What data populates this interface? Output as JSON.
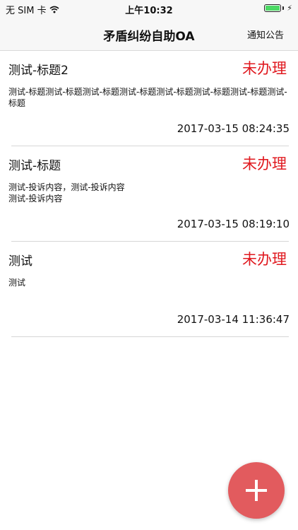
{
  "status_bar": {
    "carrier": "无 SIM 卡",
    "wifi_icon": "wifi-icon",
    "time": "上午10:32",
    "battery_level": 1.0,
    "battery_color": "#4cd964",
    "charging_icon": "⚡"
  },
  "nav": {
    "title": "矛盾纠纷自助OA",
    "right_action": "通知公告"
  },
  "list": [
    {
      "title": "测试-标题2",
      "status": "未办理",
      "content": "测试-标题测试-标题测试-标题测试-标题测试-标题测试-标题测试-标题测试-标题",
      "time": "2017-03-15 08:24:35"
    },
    {
      "title": "测试-标题",
      "status": "未办理",
      "content": "测试-投诉内容，测试-投诉内容\n测试-投诉内容",
      "time": "2017-03-15 08:19:10"
    },
    {
      "title": "测试",
      "status": "未办理",
      "content": "测试",
      "time": "2017-03-14 11:36:47"
    }
  ],
  "fab": {
    "icon": "plus-icon",
    "color": "#e25b5e"
  },
  "colors": {
    "status_red": "#e0191f"
  }
}
